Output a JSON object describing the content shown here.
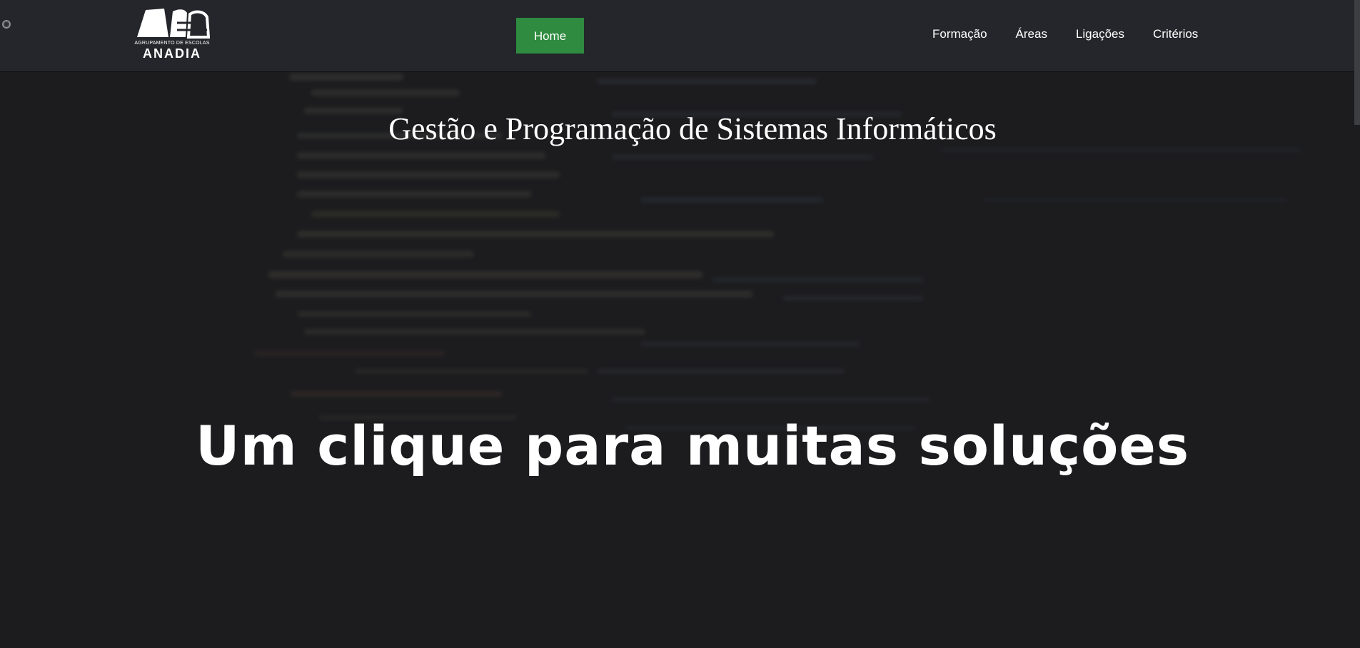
{
  "navbar": {
    "logo": {
      "small_text": "AGRUPAMENTO DE ESCOLAS",
      "big_text": "ANADIA"
    },
    "home_label": "Home",
    "links": [
      "Formação",
      "Áreas",
      "Ligações",
      "Critérios"
    ]
  },
  "hero": {
    "subtitle": "Gestão e Programação de Sistemas Informáticos",
    "headline": "Um clique para muitas soluções"
  },
  "colors": {
    "navbar_bg": "#24262b",
    "page_bg": "#1c1c1e",
    "home_button": "#2e8b3f",
    "text": "#ffffff"
  }
}
